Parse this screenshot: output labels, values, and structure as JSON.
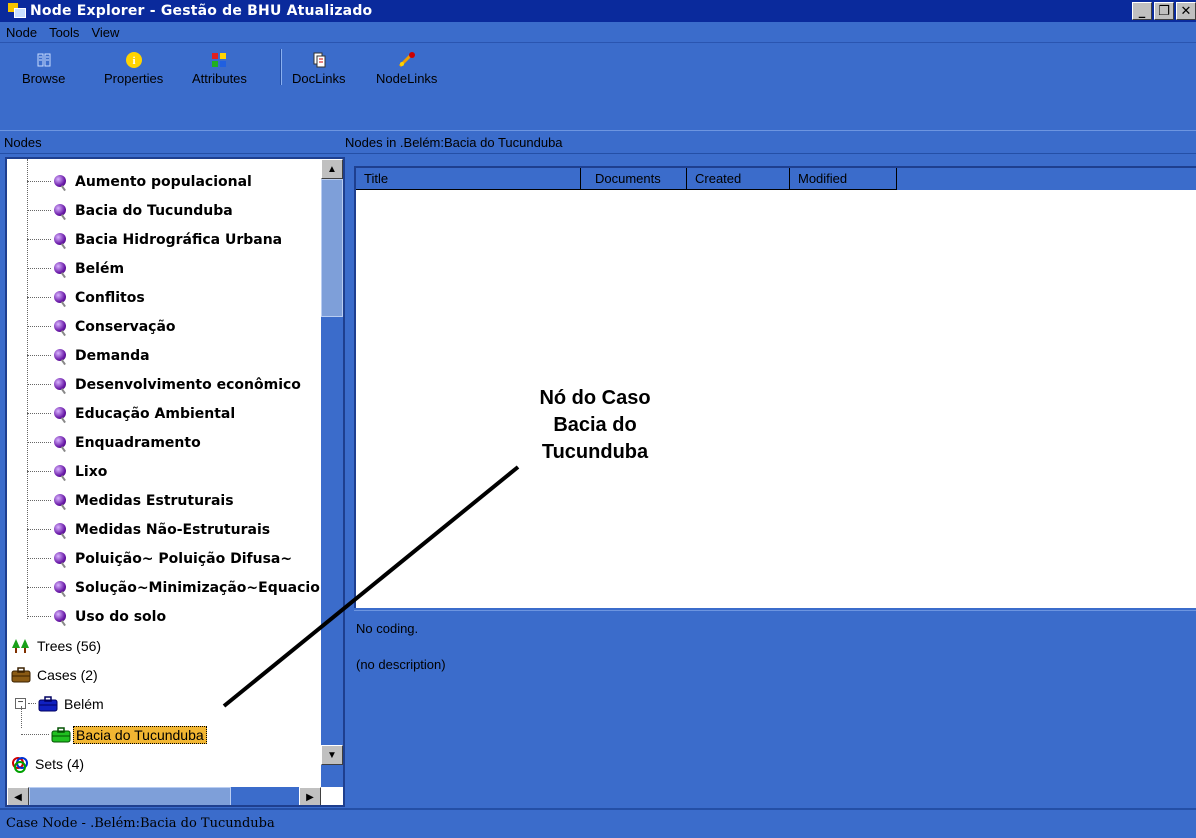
{
  "window": {
    "title": "Node Explorer - Gestão de BHU Atualizado"
  },
  "menu": {
    "items": [
      "Node",
      "Tools",
      "View"
    ]
  },
  "toolbar": {
    "buttons": [
      {
        "label": "Browse",
        "icon": "browse-icon"
      },
      {
        "label": "Properties",
        "icon": "info-icon"
      },
      {
        "label": "Attributes",
        "icon": "attributes-icon"
      },
      {
        "label": "DocLinks",
        "icon": "doclinks-icon"
      },
      {
        "label": "NodeLinks",
        "icon": "nodelinks-icon"
      }
    ]
  },
  "left_header": "Nodes",
  "right_header": "Nodes in .Belém:Bacia do Tucunduba",
  "tree": {
    "free_nodes": [
      "Aumento populacional",
      "Bacia do Tucunduba",
      "Bacia Hidrográfica Urbana",
      "Belém",
      "Conflitos",
      "Conservação",
      "Demanda",
      "Desenvolvimento econômico",
      "Educação Ambiental",
      "Enquadramento",
      "Lixo",
      "Medidas Estruturais",
      "Medidas Não-Estruturais",
      "Poluição~ Poluição Difusa~",
      "Solução~Minimização~Equacionamento",
      "Uso do solo"
    ],
    "trees_label": "Trees (56)",
    "cases_label": "Cases (2)",
    "case_parent": "Belém",
    "case_child": "Bacia do Tucunduba",
    "sets_label": "Sets (4)",
    "expand_symbol": "−"
  },
  "grid": {
    "columns": [
      "Title",
      "Documents",
      "Created",
      "Modified"
    ]
  },
  "description": {
    "coding": "No coding.",
    "text": "(no description)"
  },
  "status": "Case Node - .Belém:Bacia do Tucunduba",
  "callout": {
    "line1": "Nó do Caso",
    "line2": "Bacia do",
    "line3": "Tucunduba"
  },
  "colors": {
    "window_bg": "#3b6ccb",
    "titlebar": "#0a2a9c",
    "selection": "#f2b632"
  }
}
